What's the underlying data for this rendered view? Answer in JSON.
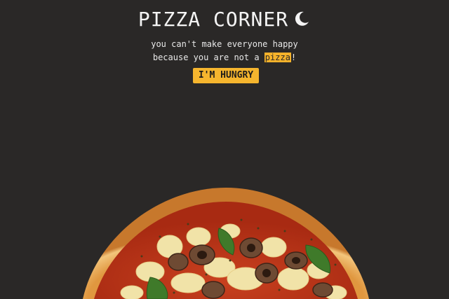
{
  "header": {
    "title": "PIZZA CORNER",
    "theme_toggle_icon": "moon-icon"
  },
  "tagline": {
    "line1": "you can't make everyone happy",
    "line2_before": "because you are not a ",
    "line2_highlight": "pizza",
    "line2_after": "!"
  },
  "cta": {
    "label": "I'M HUNGRY"
  },
  "hero_image": {
    "icon": "pizza-image"
  },
  "colors": {
    "background": "#2a2827",
    "accent": "#f5b52e",
    "text": "#f2f2f2"
  }
}
